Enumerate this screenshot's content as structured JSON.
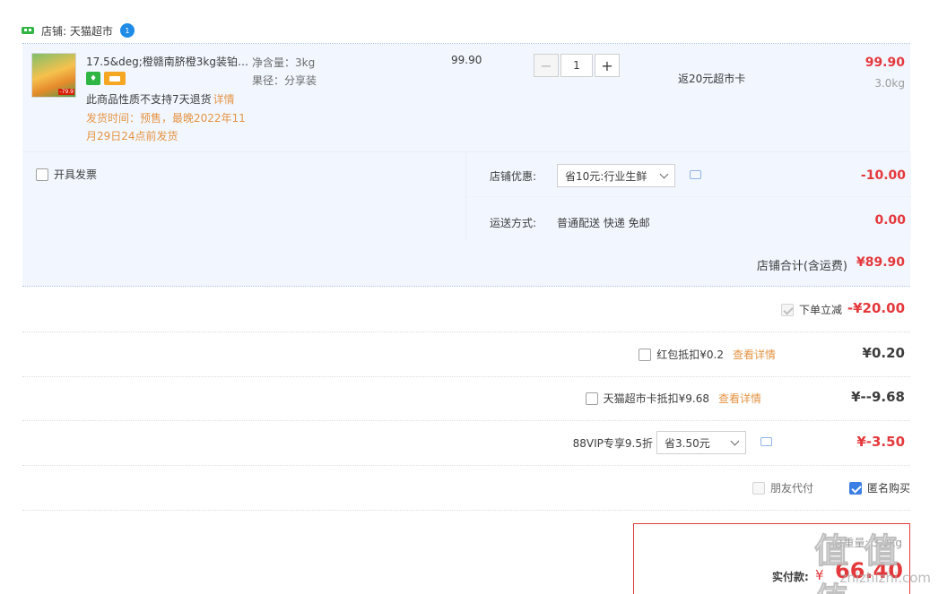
{
  "shop": {
    "label": "店铺: 天猫超市",
    "ww_badge": "1",
    "colors": {
      "accent_blue": "#1e8be6",
      "shop_icon_green": "#2fb543"
    }
  },
  "item": {
    "title": "17.5&deg;橙赣南脐橙3kg装铂…",
    "return_notice": "此商品性质不支持7天退货",
    "detail_link": "详情",
    "ship_line1": "发货时间：预售，最晚2022年11",
    "ship_line2": "月29日24点前发货",
    "attr_net": "净含量：3kg",
    "attr_size": "果径：分享装",
    "unit_price": "99.90",
    "qty": "1",
    "qty_minus": "−",
    "qty_plus": "+",
    "rebate": "返20元超市卡",
    "total": "99.90",
    "weight": "3.0kg",
    "thumb_tag": "-79.9"
  },
  "invoice": {
    "label": "开具发票"
  },
  "shop_discount": {
    "label": "店铺优惠:",
    "selected": "省10元:行业生鲜",
    "value": "-10.00"
  },
  "shipping": {
    "label": "运送方式:",
    "text": "普通配送 快递 免邮",
    "value": "0.00"
  },
  "shop_total": {
    "label": "店铺合计(含运费)",
    "value": "¥89.90"
  },
  "order_discount": {
    "label": "下单立减",
    "value": "-¥20.00"
  },
  "red_packet": {
    "label": "红包抵扣¥0.2",
    "link": "查看详情",
    "value": "¥0.20"
  },
  "tmall_card": {
    "label": "天猫超市卡抵扣¥9.68",
    "link": "查看详情",
    "value": "¥--9.68"
  },
  "vip": {
    "label": "88VIP专享9.5折",
    "selected": "省3.50元",
    "value": "¥-3.50"
  },
  "options": {
    "friend_pay": "朋友代付",
    "anonymous": "匿名购买"
  },
  "final": {
    "weight": "总重量: 3.0kg",
    "pay_label": "实付款:",
    "currency": "¥",
    "amount": "66.40"
  },
  "watermark": {
    "glyphs": "值 值 值",
    "url": "zhizhizhi.com"
  },
  "colors": {
    "price_red": "#e4393c",
    "link_orange": "#e59444",
    "panel_blue": "#f2f7ff",
    "checkbox_blue": "#3a7ee6"
  }
}
